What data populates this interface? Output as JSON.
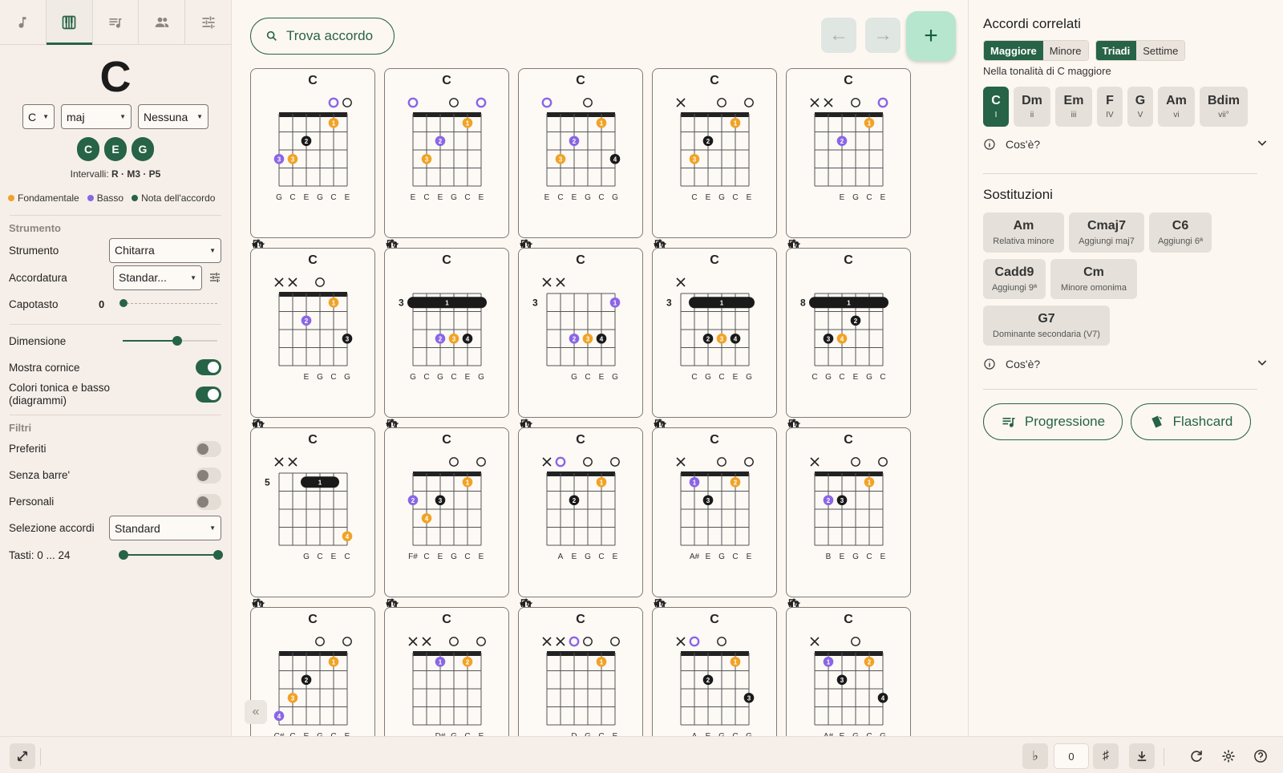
{
  "nav": {
    "tabs": [
      "note-icon",
      "piano-icon",
      "playlist-icon",
      "group-icon",
      "sliders-icon"
    ]
  },
  "chord": {
    "root_display": "C",
    "root": "C",
    "quality": "maj",
    "bass": "Nessuna",
    "notes": [
      "C",
      "E",
      "G"
    ],
    "intervals_label": "Intervalli:",
    "intervals_value": "R · M3 · P5"
  },
  "legend": {
    "root": "Fondamentale",
    "bass": "Basso",
    "chord_note": "Nota dell'accordo"
  },
  "colors": {
    "accent": "#276346",
    "root": "#f0a326",
    "bass": "#8a66e6",
    "note": "#1a1a1a",
    "fab": "#b6e6cd"
  },
  "instrument": {
    "section": "Strumento",
    "label": "Strumento",
    "value": "Chitarra",
    "tuning_label": "Accordatura",
    "tuning_value": "Standar...",
    "capo_label": "Capotasto",
    "capo_value": "0",
    "size_label": "Dimensione",
    "show_frame_label": "Mostra cornice",
    "colors_label_1": "Colori tonica e basso",
    "colors_label_2": "(diagrammi)"
  },
  "filters": {
    "section": "Filtri",
    "favorites": "Preferiti",
    "no_barre": "Senza barre'",
    "custom": "Personali",
    "selection_label": "Selezione accordi",
    "selection_value": "Standard",
    "frets_label": "Tasti: 0 ... 24"
  },
  "toolbar": {
    "search_label": "Trova accordo",
    "add": "+"
  },
  "diagrams": [
    {
      "name": "C",
      "start": 1,
      "top": [
        "",
        "",
        "",
        "",
        "b",
        "o"
      ],
      "notes": [
        [
          1,
          5,
          1,
          "r"
        ],
        [
          2,
          3,
          2,
          "n"
        ],
        [
          3,
          1,
          3,
          "b"
        ],
        [
          3,
          2,
          3,
          "r"
        ]
      ],
      "barre": null,
      "labels": [
        "G",
        "C",
        "E",
        "G",
        "C",
        "E"
      ]
    },
    {
      "name": "C",
      "start": 1,
      "top": [
        "b",
        "",
        "",
        "o",
        "",
        "b"
      ],
      "notes": [
        [
          1,
          5,
          1,
          "r"
        ],
        [
          2,
          3,
          2,
          "b"
        ],
        [
          3,
          2,
          3,
          "r"
        ]
      ],
      "barre": null,
      "labels": [
        "E",
        "C",
        "E",
        "G",
        "C",
        "E"
      ]
    },
    {
      "name": "C",
      "start": 1,
      "top": [
        "b",
        "",
        "",
        "o",
        "",
        ""
      ],
      "notes": [
        [
          1,
          5,
          1,
          "r"
        ],
        [
          2,
          3,
          2,
          "b"
        ],
        [
          3,
          2,
          3,
          "r"
        ],
        [
          3,
          6,
          4,
          "n"
        ]
      ],
      "barre": null,
      "labels": [
        "E",
        "C",
        "E",
        "G",
        "C",
        "G"
      ]
    },
    {
      "name": "C",
      "start": 1,
      "top": [
        "x",
        "",
        "",
        "o",
        "",
        "o"
      ],
      "notes": [
        [
          1,
          5,
          1,
          "r"
        ],
        [
          2,
          3,
          2,
          "n"
        ],
        [
          3,
          2,
          3,
          "r"
        ]
      ],
      "barre": null,
      "labels": [
        "",
        "C",
        "E",
        "G",
        "C",
        "E"
      ]
    },
    {
      "name": "C",
      "start": 1,
      "top": [
        "x",
        "x",
        "",
        "o",
        "",
        "b"
      ],
      "notes": [
        [
          1,
          5,
          1,
          "r"
        ],
        [
          2,
          3,
          2,
          "b"
        ]
      ],
      "barre": null,
      "labels": [
        "",
        "",
        "E",
        "G",
        "C",
        "E"
      ]
    },
    {
      "name": "C",
      "start": 1,
      "top": [
        "x",
        "x",
        "",
        "o",
        "",
        ""
      ],
      "notes": [
        [
          1,
          5,
          1,
          "r"
        ],
        [
          2,
          3,
          2,
          "b"
        ],
        [
          3,
          6,
          3,
          "n"
        ]
      ],
      "barre": null,
      "labels": [
        "",
        "",
        "E",
        "G",
        "C",
        "G"
      ]
    },
    {
      "name": "C",
      "start": 3,
      "top": [
        "",
        "",
        "",
        "",
        "",
        ""
      ],
      "notes": [
        [
          3,
          3,
          2,
          "b"
        ],
        [
          3,
          4,
          3,
          "r"
        ],
        [
          3,
          5,
          4,
          "n"
        ]
      ],
      "barre": [
        1,
        1,
        6
      ],
      "labels": [
        "G",
        "C",
        "G",
        "C",
        "E",
        "G"
      ]
    },
    {
      "name": "C",
      "start": 3,
      "top": [
        "x",
        "x",
        "",
        "",
        "",
        ""
      ],
      "notes": [
        [
          1,
          6,
          1,
          "b"
        ],
        [
          3,
          3,
          2,
          "b"
        ],
        [
          3,
          4,
          3,
          "r"
        ],
        [
          3,
          5,
          4,
          "n"
        ]
      ],
      "barre": null,
      "labels": [
        "",
        "",
        "G",
        "C",
        "E",
        "G"
      ]
    },
    {
      "name": "C",
      "start": 3,
      "top": [
        "x",
        "",
        "",
        "",
        "",
        ""
      ],
      "notes": [
        [
          3,
          3,
          2,
          "n"
        ],
        [
          3,
          4,
          3,
          "r"
        ],
        [
          3,
          5,
          4,
          "n"
        ]
      ],
      "barre": [
        1,
        2,
        6
      ],
      "labels": [
        "",
        "C",
        "G",
        "C",
        "E",
        "G"
      ]
    },
    {
      "name": "C",
      "start": 8,
      "top": [
        "",
        "",
        "",
        "",
        "",
        ""
      ],
      "notes": [
        [
          2,
          4,
          2,
          "n"
        ],
        [
          3,
          2,
          3,
          "n"
        ],
        [
          3,
          3,
          4,
          "r"
        ]
      ],
      "barre": [
        1,
        1,
        6
      ],
      "labels": [
        "C",
        "G",
        "C",
        "E",
        "G",
        "C"
      ]
    },
    {
      "name": "C",
      "start": 5,
      "top": [
        "x",
        "x",
        "",
        "",
        "",
        ""
      ],
      "notes": [
        [
          4,
          6,
          4,
          "r"
        ]
      ],
      "barre": [
        1,
        3,
        5
      ],
      "labels": [
        "",
        "",
        "G",
        "C",
        "E",
        "C"
      ]
    },
    {
      "name": "C",
      "start": 1,
      "top": [
        "",
        "",
        "",
        "o",
        "",
        "o"
      ],
      "notes": [
        [
          1,
          5,
          1,
          "r"
        ],
        [
          2,
          1,
          2,
          "b"
        ],
        [
          2,
          3,
          3,
          "n"
        ],
        [
          3,
          2,
          4,
          "r"
        ]
      ],
      "barre": null,
      "labels": [
        "F#",
        "C",
        "E",
        "G",
        "C",
        "E"
      ]
    },
    {
      "name": "C",
      "start": 1,
      "top": [
        "x",
        "b",
        "",
        "o",
        "",
        "o"
      ],
      "notes": [
        [
          1,
          5,
          1,
          "r"
        ],
        [
          2,
          3,
          2,
          "n"
        ]
      ],
      "barre": null,
      "labels": [
        "",
        "A",
        "E",
        "G",
        "C",
        "E"
      ]
    },
    {
      "name": "C",
      "start": 1,
      "top": [
        "x",
        "",
        "",
        "o",
        "",
        "o"
      ],
      "notes": [
        [
          1,
          2,
          1,
          "b"
        ],
        [
          1,
          5,
          2,
          "r"
        ],
        [
          2,
          3,
          3,
          "n"
        ]
      ],
      "barre": null,
      "labels": [
        "",
        "A#",
        "E",
        "G",
        "C",
        "E"
      ]
    },
    {
      "name": "C",
      "start": 1,
      "top": [
        "x",
        "",
        "",
        "o",
        "",
        "o"
      ],
      "notes": [
        [
          1,
          5,
          1,
          "r"
        ],
        [
          2,
          2,
          2,
          "b"
        ],
        [
          2,
          3,
          3,
          "n"
        ]
      ],
      "barre": null,
      "labels": [
        "",
        "B",
        "E",
        "G",
        "C",
        "E"
      ]
    },
    {
      "name": "C",
      "start": 1,
      "top": [
        "",
        "",
        "",
        "o",
        "",
        "o"
      ],
      "notes": [
        [
          1,
          5,
          1,
          "r"
        ],
        [
          2,
          3,
          2,
          "n"
        ],
        [
          3,
          2,
          3,
          "r"
        ],
        [
          4,
          1,
          4,
          "b"
        ]
      ],
      "barre": null,
      "labels": [
        "C#",
        "C",
        "E",
        "G",
        "C",
        "E"
      ]
    },
    {
      "name": "C",
      "start": 1,
      "top": [
        "x",
        "x",
        "",
        "o",
        "",
        "o"
      ],
      "notes": [
        [
          1,
          3,
          1,
          "b"
        ],
        [
          1,
          5,
          2,
          "r"
        ]
      ],
      "barre": null,
      "labels": [
        "",
        "",
        "D#",
        "G",
        "C",
        "E"
      ]
    },
    {
      "name": "C",
      "start": 1,
      "top": [
        "x",
        "x",
        "b",
        "o",
        "",
        "o"
      ],
      "notes": [
        [
          1,
          5,
          1,
          "r"
        ]
      ],
      "barre": null,
      "labels": [
        "",
        "",
        "D",
        "G",
        "C",
        "E"
      ]
    },
    {
      "name": "C",
      "start": 1,
      "top": [
        "x",
        "b",
        "",
        "o",
        "",
        ""
      ],
      "notes": [
        [
          1,
          5,
          1,
          "r"
        ],
        [
          2,
          3,
          2,
          "n"
        ],
        [
          3,
          6,
          3,
          "n"
        ]
      ],
      "barre": null,
      "labels": [
        "",
        "A",
        "E",
        "G",
        "C",
        "G"
      ]
    },
    {
      "name": "C",
      "start": 1,
      "top": [
        "x",
        "",
        "",
        "o",
        "",
        ""
      ],
      "notes": [
        [
          1,
          2,
          1,
          "b"
        ],
        [
          1,
          5,
          2,
          "r"
        ],
        [
          2,
          3,
          3,
          "n"
        ],
        [
          3,
          6,
          4,
          "n"
        ]
      ],
      "barre": null,
      "labels": [
        "",
        "A#",
        "E",
        "G",
        "C",
        "G"
      ]
    }
  ],
  "right": {
    "title": "Accordi correlati",
    "seg1": [
      "Maggiore",
      "Minore"
    ],
    "seg2": [
      "Triadi",
      "Settime"
    ],
    "key_caption": "Nella tonalità di C maggiore",
    "degrees": [
      {
        "name": "C",
        "deg": "I"
      },
      {
        "name": "Dm",
        "deg": "ii"
      },
      {
        "name": "Em",
        "deg": "iii"
      },
      {
        "name": "F",
        "deg": "IV"
      },
      {
        "name": "G",
        "deg": "V"
      },
      {
        "name": "Am",
        "deg": "vi"
      },
      {
        "name": "Bdim",
        "deg": "vii°"
      }
    ],
    "whats_this": "Cos'è?",
    "subs_title": "Sostituzioni",
    "subs": [
      {
        "name": "Am",
        "desc": "Relativa minore"
      },
      {
        "name": "Cmaj7",
        "desc": "Aggiungi maj7"
      },
      {
        "name": "C6",
        "desc": "Aggiungi 6ª"
      },
      {
        "name": "Cadd9",
        "desc": "Aggiungi 9ª"
      },
      {
        "name": "Cm",
        "desc": "Minore omonima"
      },
      {
        "name": "G7",
        "desc": "Dominante secondaria (V7)"
      }
    ],
    "progression_label": "Progressione",
    "flashcard_label": "Flashcard"
  },
  "bottom": {
    "flat": "♭",
    "transpose": "0",
    "sharp": "♯"
  }
}
